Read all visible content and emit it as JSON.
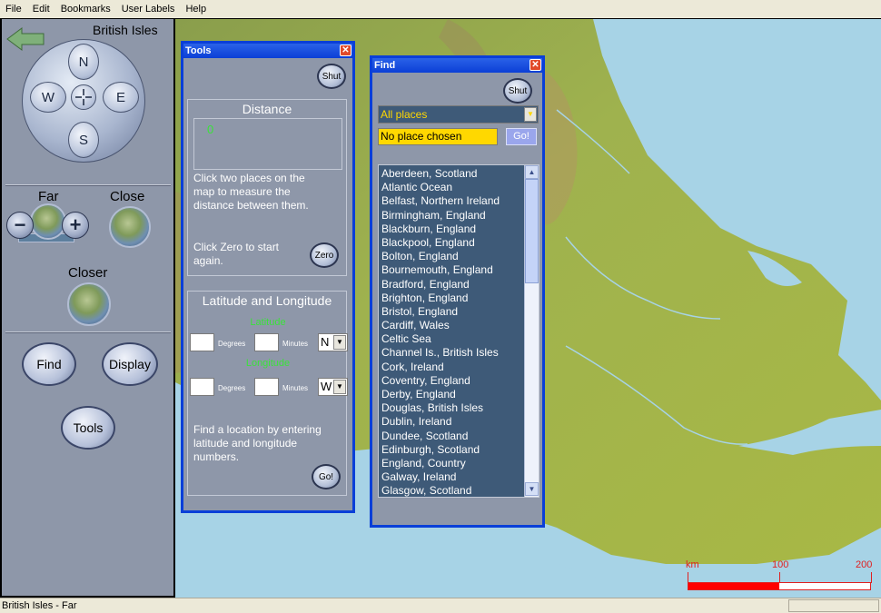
{
  "menu": [
    "File",
    "Edit",
    "Bookmarks",
    "User Labels",
    "Help"
  ],
  "left": {
    "region_title": "British Isles",
    "compass": {
      "n": "N",
      "s": "S",
      "e": "E",
      "w": "W",
      "center": "-|-"
    },
    "zoom": {
      "far_label": "Far",
      "close_label": "Close",
      "minus": "−",
      "plus": "+",
      "closer_label": "Closer"
    },
    "buttons": {
      "find": "Find",
      "display": "Display",
      "tools": "Tools"
    }
  },
  "tools_window": {
    "title": "Tools",
    "shut": "Shut",
    "distance": {
      "title": "Distance",
      "value": "0",
      "instructions": "Click two places on the map to measure the distance between them.",
      "zero_hint": "Click Zero to start again.",
      "zero_button": "Zero"
    },
    "latlong": {
      "title": "Latitude and Longitude",
      "latitude_label": "Latitude",
      "longitude_label": "Longitude",
      "degrees": "Degrees",
      "minutes": "Minutes",
      "lat_dir": "N",
      "long_dir": "W",
      "instructions": "Find a location by entering latitude and longitude numbers.",
      "go_button": "Go!"
    }
  },
  "find_window": {
    "title": "Find",
    "shut": "Shut",
    "filter": "All places",
    "search_value": "No place chosen",
    "go_button": "Go!",
    "places": [
      "Aberdeen, Scotland",
      "Atlantic Ocean",
      "Belfast, Northern Ireland",
      "Birmingham, England",
      "Blackburn, England",
      "Blackpool, England",
      "Bolton, England",
      "Bournemouth, England",
      "Bradford, England",
      "Brighton, England",
      "Bristol, England",
      "Cardiff, Wales",
      "Celtic Sea",
      "Channel Is., British Isles",
      "Cork, Ireland",
      "Coventry, England",
      "Derby, England",
      "Douglas, British Isles",
      "Dublin, Ireland",
      "Dundee, Scotland",
      "Edinburgh, Scotland",
      "England, Country",
      "Galway, Ireland",
      "Glasgow, Scotland"
    ]
  },
  "scale": {
    "unit": "km",
    "mid": "100",
    "max": "200"
  },
  "status": {
    "text": "British Isles - Far"
  },
  "colors": {
    "window_border": "#0a3fd8",
    "panel": "#8e97a9",
    "list_bg": "#3e5a78",
    "search_bg": "#ffd800",
    "scale_red": "#ff0000"
  }
}
